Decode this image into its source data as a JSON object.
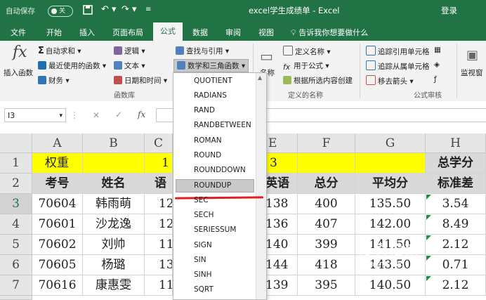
{
  "titlebar": {
    "autosave": "自动保存",
    "toggle": "关",
    "title": "excel学生成绩单 - Excel",
    "login": "登录",
    "color": "#217346"
  },
  "tabs": [
    {
      "label": "文件"
    },
    {
      "label": "开始"
    },
    {
      "label": "插入"
    },
    {
      "label": "页面布局"
    },
    {
      "label": "公式"
    },
    {
      "label": "数据"
    },
    {
      "label": "审阅"
    },
    {
      "label": "视图"
    },
    {
      "label": "告诉我你想要做什么"
    }
  ],
  "ribbon": {
    "insert_fn": "插入函数",
    "fx": "fx",
    "autosum": "自动求和",
    "recent": "最近使用的函数",
    "finance": "财务",
    "logic": "逻辑",
    "text": "文本",
    "datetime": "日期和时间",
    "lookup": "查找与引用",
    "mathtrig": "数学和三角函数",
    "group_lib": "函数库",
    "name_mgr": "名称",
    "define_name": "定义名称",
    "use_in_formula": "用于公式",
    "create_from_sel": "根据所选内容创建",
    "group_names": "定义的名称",
    "trace_prec": "追踪引用单元格",
    "trace_dep": "追踪从属单元格",
    "remove_arrows": "移去箭头",
    "group_audit": "公式审核",
    "watch": "监视窗"
  },
  "formula_bar": {
    "cell_ref": "I3",
    "cancel": "✕",
    "enter": "✓",
    "fx": "fx"
  },
  "columns": [
    "A",
    "B",
    "C",
    "E",
    "F",
    "G",
    "H"
  ],
  "rows": [
    "1",
    "2",
    "3",
    "4",
    "5",
    "6",
    "7"
  ],
  "sheet": {
    "r1": {
      "a": "权重",
      "c": "1",
      "e": "3",
      "h": "总学分"
    },
    "r2": {
      "a": "考号",
      "b": "姓名",
      "c": "语",
      "e": "英语",
      "f": "总分",
      "g": "平均分",
      "h": "标准差"
    },
    "data": [
      {
        "a": "70604",
        "b": "韩雨萌",
        "c": "12",
        "e": "138",
        "f": "400",
        "g": "135.50",
        "h": "3.54"
      },
      {
        "a": "70601",
        "b": "沙龙逸",
        "c": "12",
        "e": "136",
        "f": "407",
        "g": "142.00",
        "h": "8.49"
      },
      {
        "a": "70602",
        "b": "刘帅",
        "c": "11",
        "e": "140",
        "f": "399",
        "g": "141.50",
        "h": "2.12"
      },
      {
        "a": "70605",
        "b": "杨璐",
        "c": "13",
        "e": "144",
        "f": "418",
        "g": "143.50",
        "h": "0.71"
      },
      {
        "a": "70616",
        "b": "康惠雯",
        "c": "11",
        "e": "139",
        "f": "395",
        "g": "140.50",
        "h": "2.12"
      }
    ]
  },
  "dropdown": {
    "items": [
      "QUOTIENT",
      "RADIANS",
      "RAND",
      "RANDBETWEEN",
      "ROMAN",
      "ROUND",
      "ROUNDDOWN",
      "ROUNDUP",
      "SEC",
      "SECH",
      "SERIESSUM",
      "SIGN",
      "SIN",
      "SINH",
      "SQRT"
    ],
    "highlighted_index": 7
  },
  "watermark": {
    "line1": "搜狗指南",
    "line2": "zhinan.sogou.com"
  }
}
